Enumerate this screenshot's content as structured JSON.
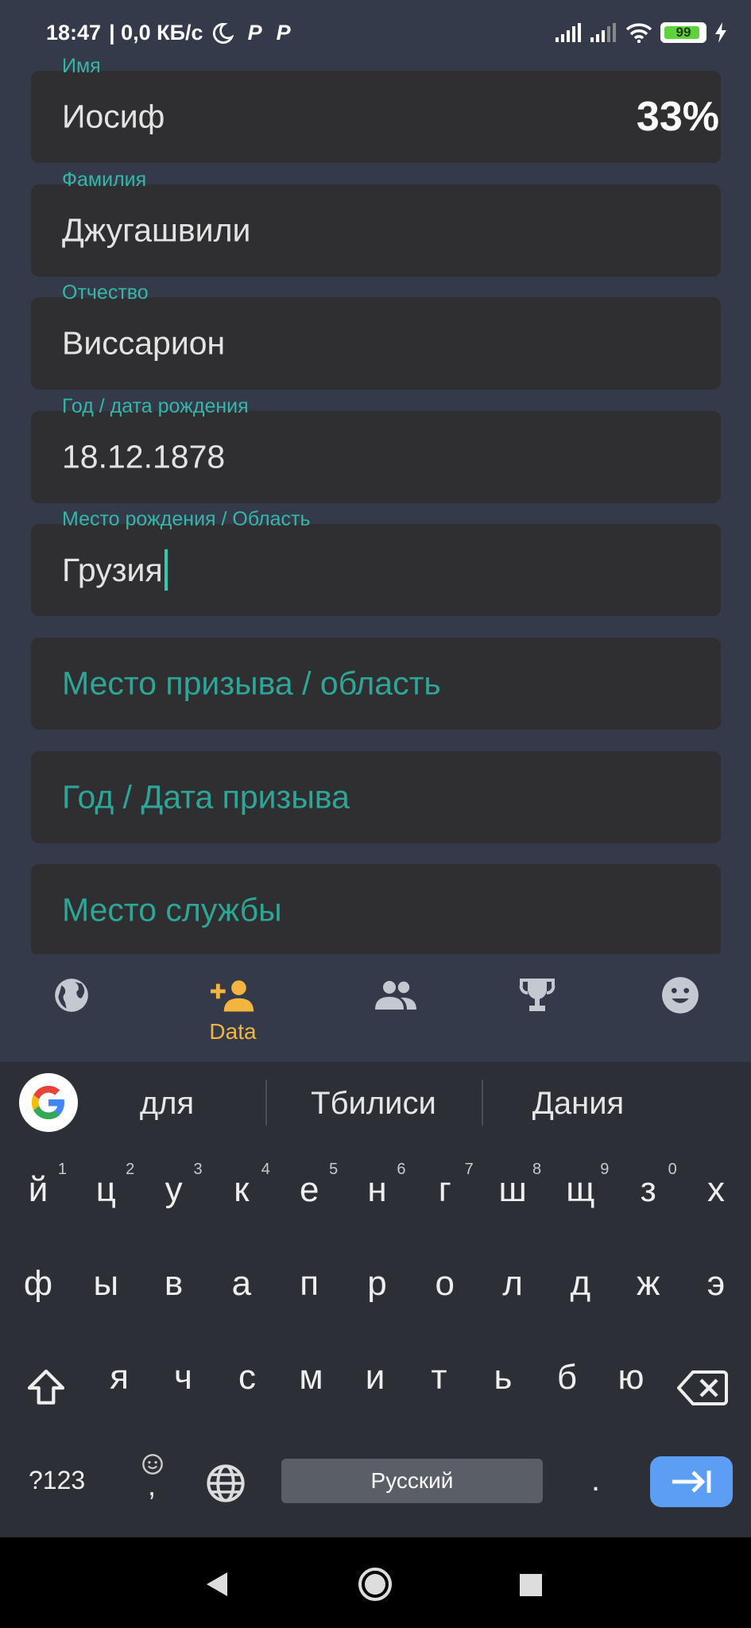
{
  "status_bar": {
    "time": "18:47",
    "network_speed": "| 0,0 КБ/с",
    "app_icon_1": "P",
    "app_icon_2": "P",
    "battery": "99",
    "icons": [
      "moon-icon",
      "signal-icon",
      "signal-icon",
      "wifi-icon",
      "battery-icon",
      "charging-icon"
    ]
  },
  "form": {
    "progress": "33%",
    "fields": [
      {
        "label": "Имя",
        "value": "Иосиф"
      },
      {
        "label": "Фамилия",
        "value": "Джугашвили"
      },
      {
        "label": "Отчество",
        "value": "Виссарион"
      },
      {
        "label": "Год / дата рождения",
        "value": "18.12.1878"
      },
      {
        "label": "Место рождения / Область",
        "value": "Грузия"
      },
      {
        "placeholder": "Место призыва / область"
      },
      {
        "placeholder": "Год / Дата призыва"
      },
      {
        "placeholder": "Место службы"
      }
    ]
  },
  "bottom_nav": {
    "active_label": "Data",
    "items": [
      "globe-icon",
      "add-person-icon",
      "group-icon",
      "trophy-icon",
      "smiley-icon"
    ],
    "active_color": "#f3b53f",
    "inactive_color": "#c4c8d0"
  },
  "keyboard": {
    "suggestions": [
      "для",
      "Тбилиси",
      "Дания"
    ],
    "row1": [
      "й",
      "ц",
      "у",
      "к",
      "е",
      "н",
      "г",
      "ш",
      "щ",
      "з",
      "х"
    ],
    "row1_hints": [
      "1",
      "2",
      "3",
      "4",
      "5",
      "6",
      "7",
      "8",
      "9",
      "0"
    ],
    "row2": [
      "ф",
      "ы",
      "в",
      "а",
      "п",
      "р",
      "о",
      "л",
      "д",
      "ж",
      "э"
    ],
    "row3": [
      "я",
      "ч",
      "с",
      "м",
      "и",
      "т",
      "ь",
      "б",
      "ю"
    ],
    "symbols_label": "?123",
    "comma_label": ",",
    "space_label": "Русский",
    "period_label": "."
  },
  "colors": {
    "background": "#343a4a",
    "field_bg": "#2f2f31",
    "accent_teal": "#35b6a6",
    "keyboard_bg": "#2c3036",
    "enter_key": "#5c9ef3"
  }
}
